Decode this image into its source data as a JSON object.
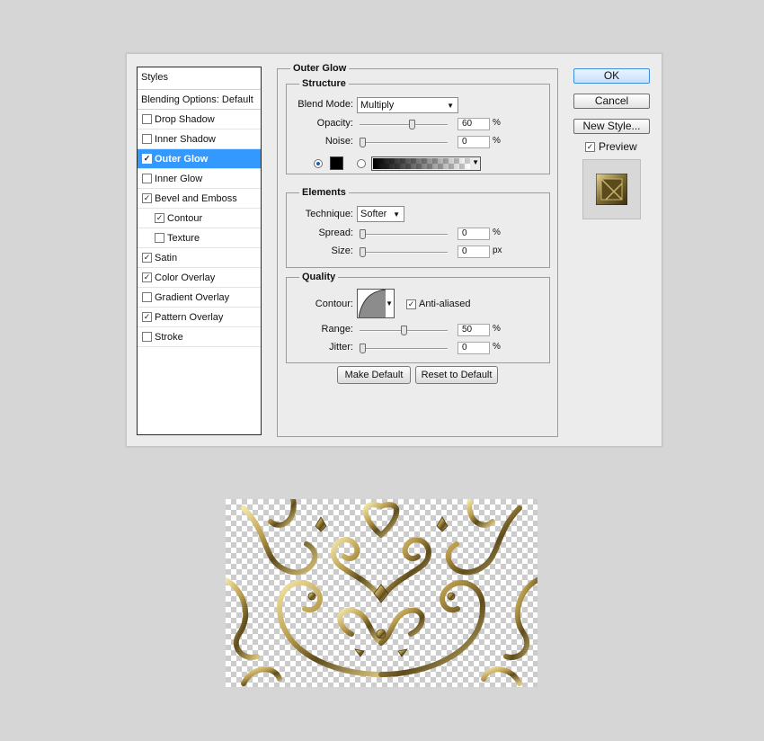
{
  "styles_panel": {
    "header": "Styles",
    "blending_options": "Blending Options: Default",
    "items": [
      {
        "label": "Drop Shadow",
        "checked": false,
        "selected": false,
        "indent": false
      },
      {
        "label": "Inner Shadow",
        "checked": false,
        "selected": false,
        "indent": false
      },
      {
        "label": "Outer Glow",
        "checked": true,
        "selected": true,
        "indent": false
      },
      {
        "label": "Inner Glow",
        "checked": false,
        "selected": false,
        "indent": false
      },
      {
        "label": "Bevel and Emboss",
        "checked": true,
        "selected": false,
        "indent": false
      },
      {
        "label": "Contour",
        "checked": true,
        "selected": false,
        "indent": true
      },
      {
        "label": "Texture",
        "checked": false,
        "selected": false,
        "indent": true
      },
      {
        "label": "Satin",
        "checked": true,
        "selected": false,
        "indent": false
      },
      {
        "label": "Color Overlay",
        "checked": true,
        "selected": false,
        "indent": false
      },
      {
        "label": "Gradient Overlay",
        "checked": false,
        "selected": false,
        "indent": false
      },
      {
        "label": "Pattern Overlay",
        "checked": true,
        "selected": false,
        "indent": false
      },
      {
        "label": "Stroke",
        "checked": false,
        "selected": false,
        "indent": false
      }
    ]
  },
  "outer_glow": {
    "title": "Outer Glow",
    "structure": {
      "title": "Structure",
      "blend_mode_label": "Blend Mode:",
      "blend_mode_value": "Multiply",
      "opacity_label": "Opacity:",
      "opacity_value": "60",
      "opacity_unit": "%",
      "noise_label": "Noise:",
      "noise_value": "0",
      "noise_unit": "%",
      "color_mode": "solid",
      "glow_color": "#000000"
    },
    "elements": {
      "title": "Elements",
      "technique_label": "Technique:",
      "technique_value": "Softer",
      "spread_label": "Spread:",
      "spread_value": "0",
      "spread_unit": "%",
      "size_label": "Size:",
      "size_value": "0",
      "size_unit": "px"
    },
    "quality": {
      "title": "Quality",
      "contour_label": "Contour:",
      "anti_aliased_label": "Anti-aliased",
      "anti_aliased_checked": true,
      "range_label": "Range:",
      "range_value": "50",
      "range_unit": "%",
      "jitter_label": "Jitter:",
      "jitter_value": "0",
      "jitter_unit": "%"
    },
    "make_default_label": "Make Default",
    "reset_default_label": "Reset to Default"
  },
  "actions": {
    "ok_label": "OK",
    "cancel_label": "Cancel",
    "new_style_label": "New Style...",
    "preview_label": "Preview",
    "preview_checked": true
  },
  "colors": {
    "selection": "#3399ff",
    "gold": "#a08a4a",
    "dialog_bg": "#ececec",
    "page_bg": "#d6d6d6"
  }
}
